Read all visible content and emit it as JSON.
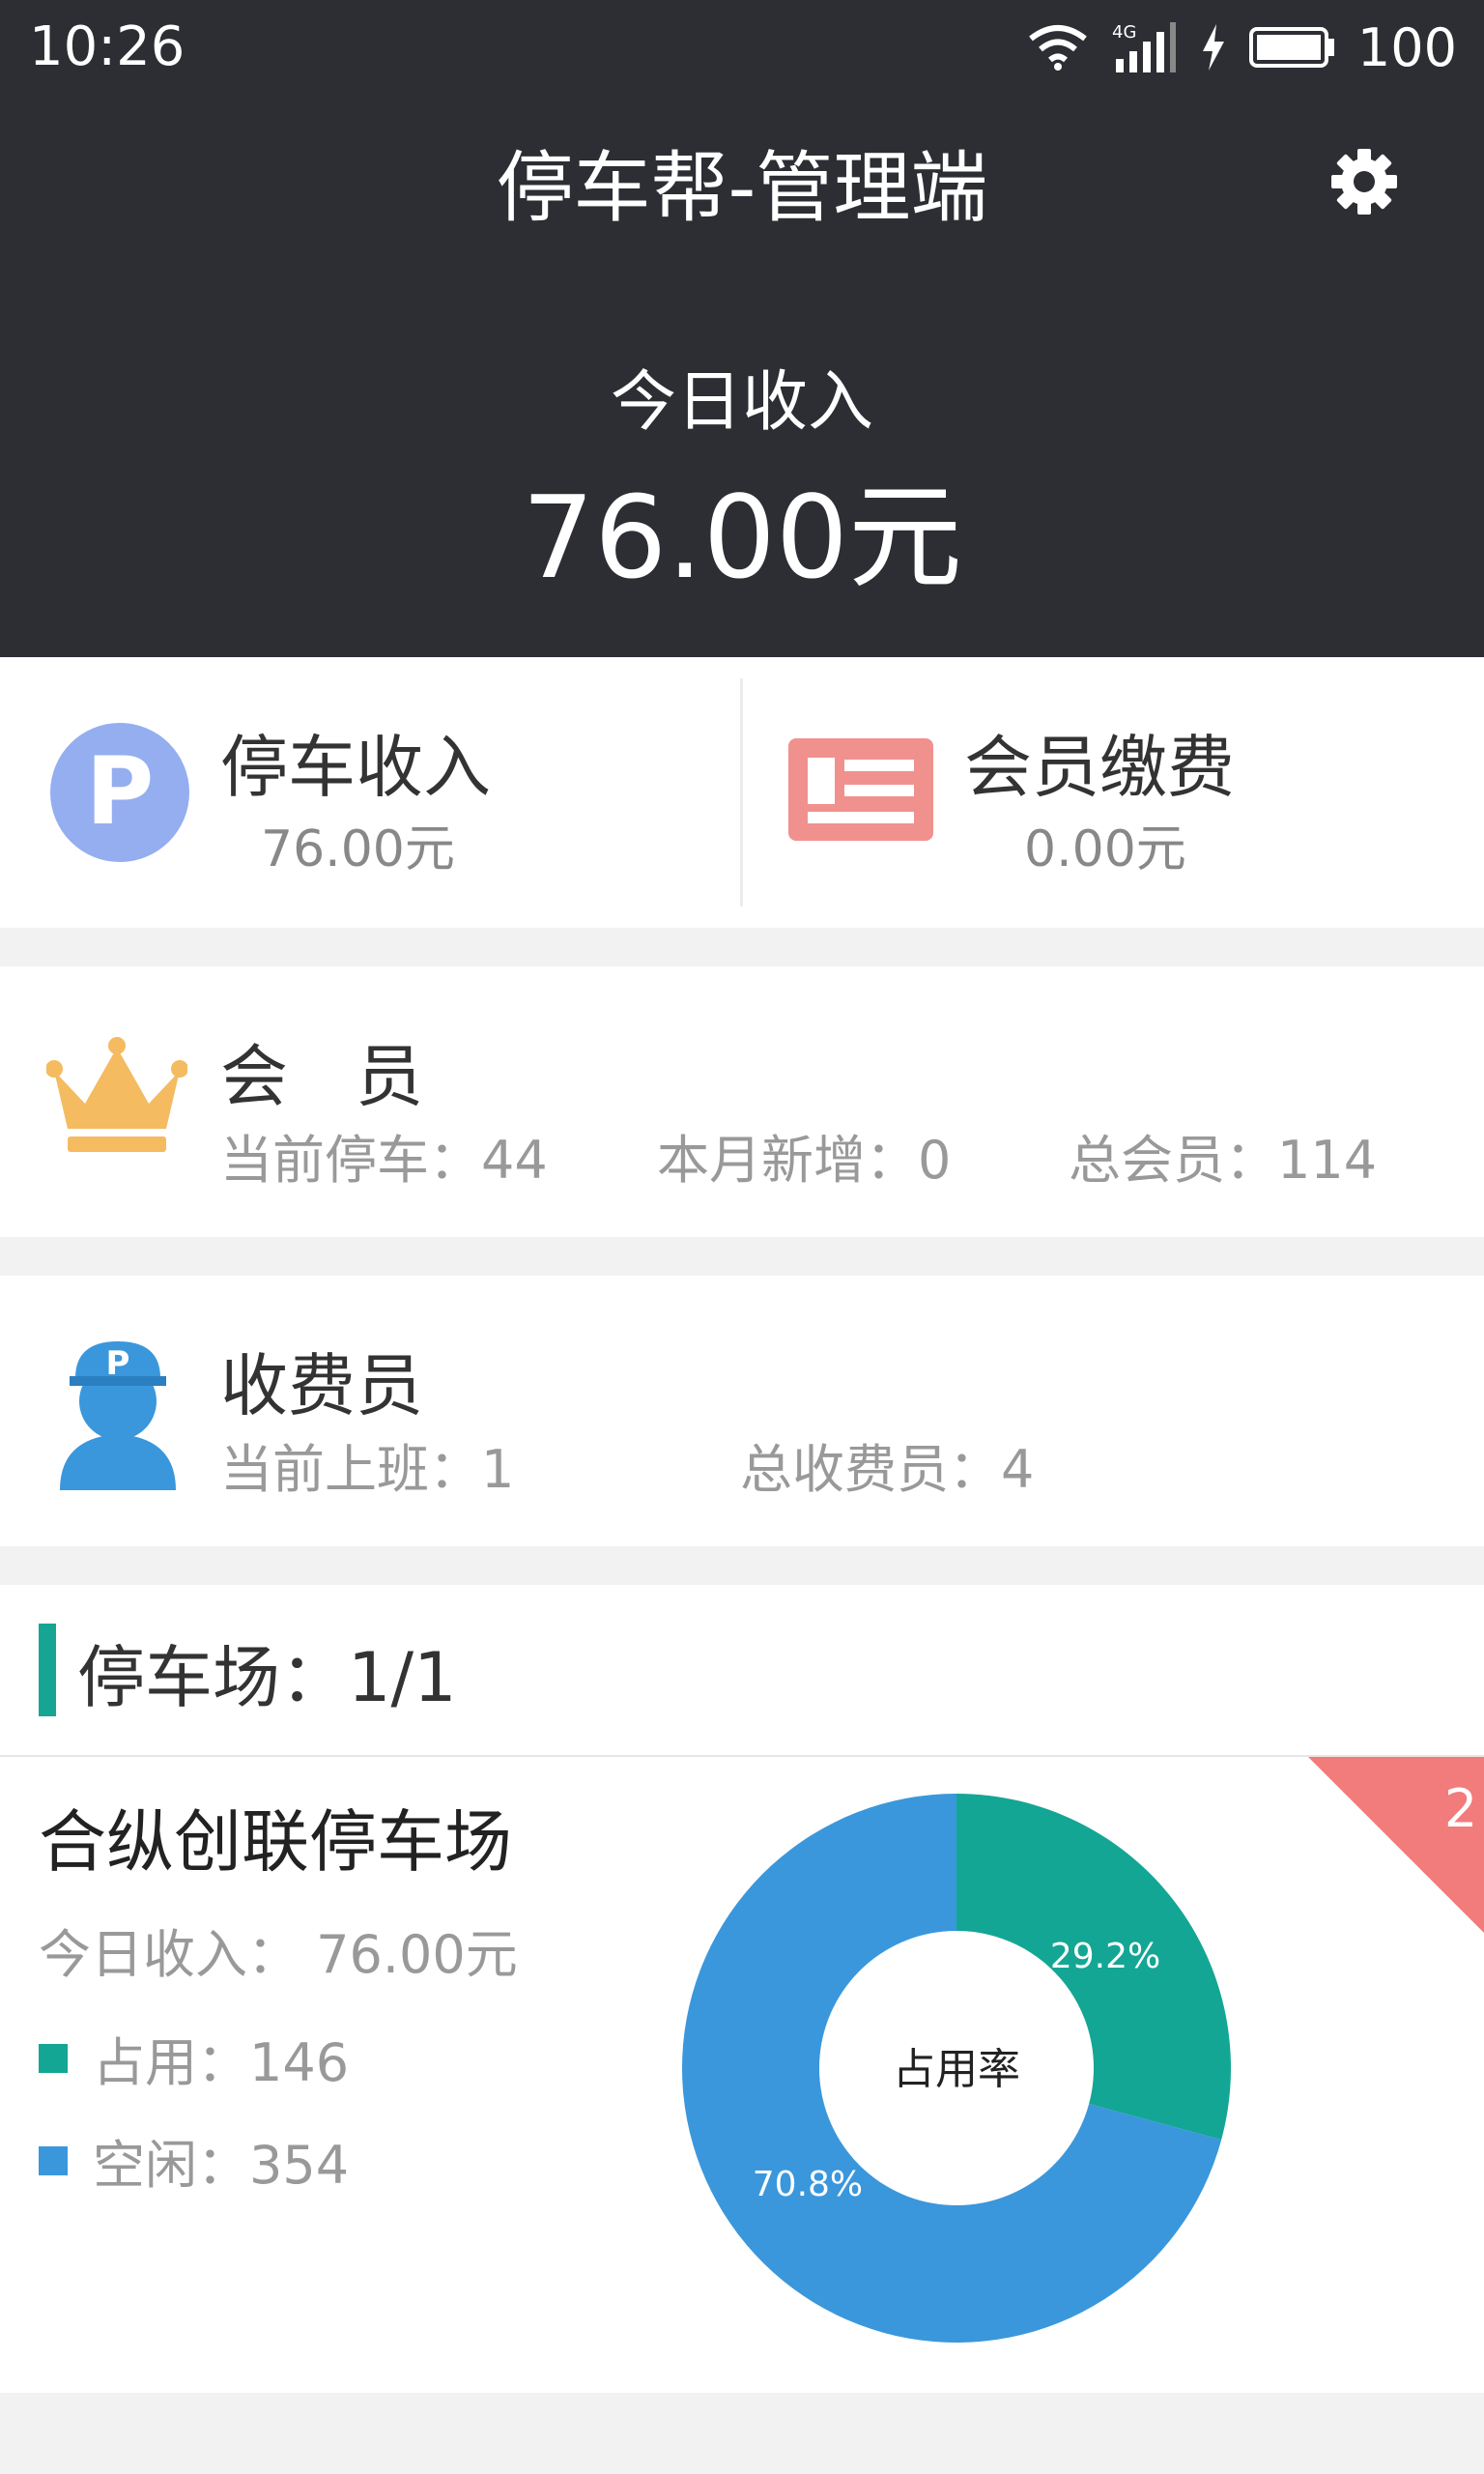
{
  "status": {
    "time": "10:26",
    "network": "4G",
    "battery": "100"
  },
  "header": {
    "title": "停车帮-管理端",
    "income_label": "今日收入",
    "income_value": "76.00元"
  },
  "income_cards": [
    {
      "title": "停车收入",
      "value": "76.00元",
      "icon": "parking-p-icon",
      "color": "#94aef0"
    },
    {
      "title": "会员缴费",
      "value": "0.00元",
      "icon": "card-icon",
      "color": "#f0918e"
    }
  ],
  "member": {
    "title": "会　员",
    "current_parking": "当前停车：44",
    "new_this_month": "本月新增：0",
    "total_members": "总会员：114"
  },
  "collector": {
    "title": "收费员",
    "on_duty": "当前上班：1",
    "total_collectors": "总收费员：4"
  },
  "parking": {
    "header": "停车场：1/1",
    "lot_name": "合纵创联停车场",
    "lot_income": "今日收入：  76.00元",
    "badge": "2",
    "legend": [
      {
        "label": "占用：146",
        "color": "#14a694"
      },
      {
        "label": "空闲：354",
        "color": "#3a97dc"
      }
    ]
  },
  "chart_data": {
    "type": "pie",
    "center_label": "占用率",
    "slices": [
      {
        "label": "29.2%",
        "value": 146,
        "color": "#14a694"
      },
      {
        "label": "70.8%",
        "value": 354,
        "color": "#3a97dc"
      }
    ]
  },
  "colors": {
    "header_bg": "#2c2e34",
    "accent": "#16a593",
    "badge": "#f27b7b"
  }
}
